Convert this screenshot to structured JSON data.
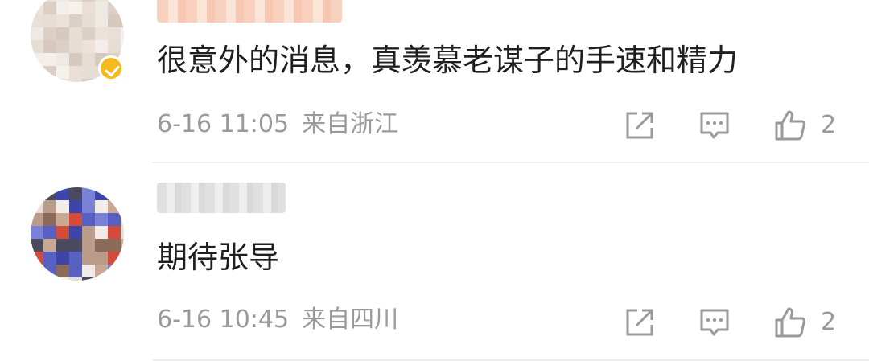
{
  "colors": {
    "text_primary": "#1f1f1f",
    "text_secondary": "#9a9a9a",
    "vip_badge": "#f6b91c",
    "divider": "#ececec"
  },
  "comments": [
    {
      "text": "很意外的消息，真羡慕老谋子的手速和精力",
      "date": "6-16 11:05",
      "location": "来自浙江",
      "likes": "2",
      "avatar_icon": "blurred-avatar",
      "badge_icon": "vip-badge-icon",
      "actions": [
        "share-icon",
        "reply-icon",
        "like-icon"
      ]
    },
    {
      "text": "期待张导",
      "date": "6-16 10:45",
      "location": "来自四川",
      "likes": "2",
      "avatar_icon": "blurred-avatar",
      "actions": [
        "share-icon",
        "reply-icon",
        "like-icon"
      ]
    }
  ]
}
